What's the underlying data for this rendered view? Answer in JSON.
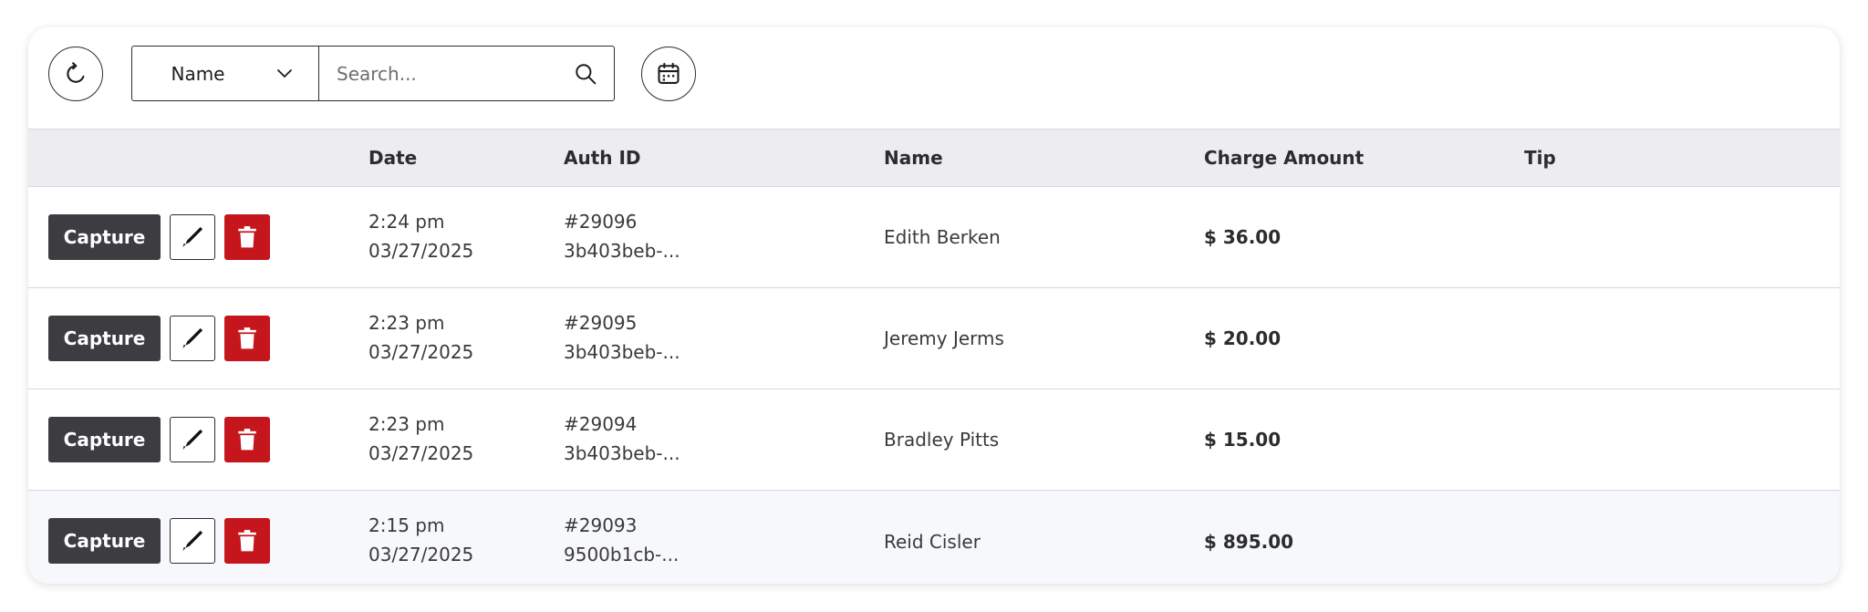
{
  "toolbar": {
    "filter_select": {
      "value": "Name"
    },
    "search": {
      "value": "",
      "placeholder": "Search..."
    }
  },
  "table": {
    "columns": [
      "",
      "Date",
      "Auth ID",
      "Name",
      "Charge Amount",
      "Tip"
    ],
    "actions": {
      "capture_label": "Capture"
    },
    "rows": [
      {
        "time": "2:24 pm",
        "date": "03/27/2025",
        "auth_num": "#29096",
        "auth_hash": "3b403beb-...",
        "name": "Edith Berken",
        "amount": "$ 36.00",
        "tip": ""
      },
      {
        "time": "2:23 pm",
        "date": "03/27/2025",
        "auth_num": "#29095",
        "auth_hash": "3b403beb-...",
        "name": "Jeremy Jerms",
        "amount": "$ 20.00",
        "tip": ""
      },
      {
        "time": "2:23 pm",
        "date": "03/27/2025",
        "auth_num": "#29094",
        "auth_hash": "3b403beb-...",
        "name": "Bradley Pitts",
        "amount": "$ 15.00",
        "tip": ""
      },
      {
        "time": "2:15 pm",
        "date": "03/27/2025",
        "auth_num": "#29093",
        "auth_hash": "9500b1cb-...",
        "name": "Reid Cisler",
        "amount": "$ 895.00",
        "tip": ""
      }
    ]
  },
  "colors": {
    "capture_button": "#3c3c41",
    "delete_button": "#c4161c",
    "header_background": "#ededef",
    "highlighted_row_background": "#f7f8fc"
  },
  "icons": {
    "refresh": "refresh-icon",
    "dropdown": "chevron-down-icon",
    "search": "search-icon",
    "calendar": "calendar-icon",
    "edit": "pencil-icon",
    "delete": "trash-icon"
  }
}
